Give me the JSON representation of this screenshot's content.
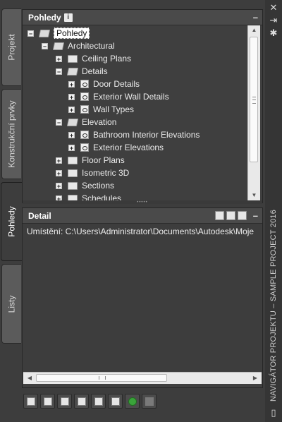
{
  "tabs": [
    {
      "label": "Projekt"
    },
    {
      "label": "Konstrukční prvky"
    },
    {
      "label": "Pohledy"
    },
    {
      "label": "Listy"
    }
  ],
  "views_panel": {
    "title": "Pohledy",
    "info_icon": "i",
    "collapse_label": "–"
  },
  "tree": {
    "items": [
      {
        "label": "Pohledy",
        "level": 0,
        "expander": "−",
        "icon": "folder-open-icon",
        "selected": true
      },
      {
        "label": "Architectural",
        "level": 1,
        "expander": "−",
        "icon": "folder-open-icon"
      },
      {
        "label": "Ceiling Plans",
        "level": 2,
        "expander": "+",
        "icon": "folder-icon"
      },
      {
        "label": "Details",
        "level": 2,
        "expander": "−",
        "icon": "folder-open-icon"
      },
      {
        "label": "Door Details",
        "level": 3,
        "expander": "+",
        "icon": "view-icon"
      },
      {
        "label": "Exterior Wall Details",
        "level": 3,
        "expander": "+",
        "icon": "view-icon"
      },
      {
        "label": "Wall Types",
        "level": 3,
        "expander": "+",
        "icon": "view-icon"
      },
      {
        "label": "Elevation",
        "level": 2,
        "expander": "−",
        "icon": "folder-open-icon"
      },
      {
        "label": "Bathroom Interior Elevations",
        "level": 3,
        "expander": "+",
        "icon": "view-icon"
      },
      {
        "label": "Exterior Elevations",
        "level": 3,
        "expander": "+",
        "icon": "view-icon"
      },
      {
        "label": "Floor Plans",
        "level": 2,
        "expander": "+",
        "icon": "folder-icon"
      },
      {
        "label": "Isometric 3D",
        "level": 2,
        "expander": "+",
        "icon": "folder-icon"
      },
      {
        "label": "Sections",
        "level": 2,
        "expander": "+",
        "icon": "folder-icon"
      },
      {
        "label": "Schedules",
        "level": 2,
        "expander": "+",
        "icon": "folder-icon"
      }
    ]
  },
  "detail_panel": {
    "title": "Detail",
    "collapse_label": "–",
    "location": "Umístění: C:\\Users\\Administrator\\Documents\\Autodesk\\Moje"
  },
  "sidebar_title": "NAVIGÁTOR PROJEKTU – SAMPLE PROJECT 2016",
  "right_strip": {
    "close": "✕",
    "pin": "⇥",
    "settings": "✱"
  },
  "toolbar": {
    "buttons": [
      "new-view-icon",
      "properties-icon",
      "reposition-icon",
      "clipboard-icon",
      "cursor-icon",
      "table-icon",
      "refresh-icon",
      "drawing-icon"
    ]
  }
}
